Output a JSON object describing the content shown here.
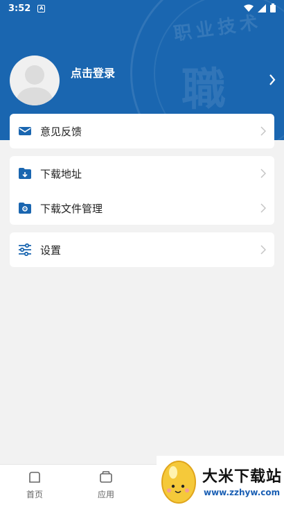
{
  "status_bar": {
    "time": "3:52",
    "notification_glyph": "A"
  },
  "header": {
    "login_text": "点击登录"
  },
  "menu": {
    "feedback": {
      "label": "意见反馈",
      "icon": "mail-icon"
    },
    "download_address": {
      "label": "下载地址",
      "icon": "folder-download-icon"
    },
    "download_manager": {
      "label": "下载文件管理",
      "icon": "folder-settings-icon"
    },
    "settings": {
      "label": "设置",
      "icon": "sliders-icon"
    }
  },
  "tabs": [
    {
      "label": "首页",
      "icon": "home-icon"
    },
    {
      "label": "应用",
      "icon": "wallet-icon"
    }
  ],
  "watermark": {
    "brand_name": "大米下载站",
    "brand_url": "www.zzhyw.com"
  },
  "colors": {
    "primary": "#1a66b0",
    "background": "#f2f2f2",
    "card": "#ffffff"
  }
}
